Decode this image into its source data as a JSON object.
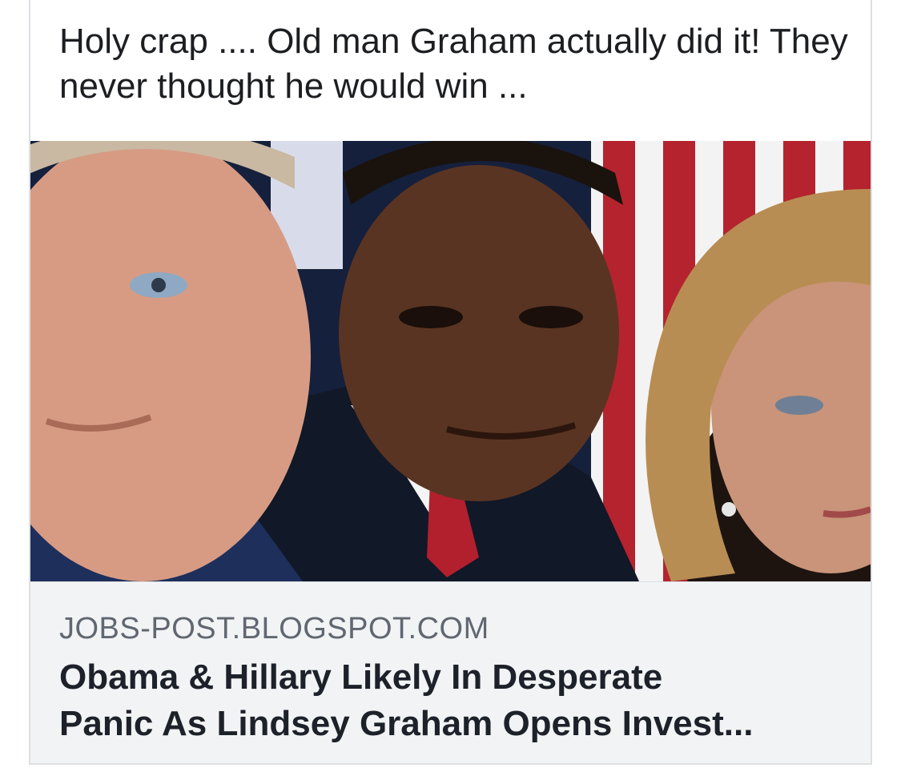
{
  "post": {
    "text": "Holy crap .... Old man Graham actually did it! They never thought he would win ..."
  },
  "link_preview": {
    "domain": "JOBS-POST.BLOGSPOT.COM",
    "title": "Obama & Hillary Likely In Desperate\nPanic As Lindsey Graham Opens Invest..."
  },
  "colors": {
    "footer_bg": "#f2f3f5",
    "domain_text": "#606770",
    "title_text": "#1d2129",
    "border": "#dddfe2"
  }
}
